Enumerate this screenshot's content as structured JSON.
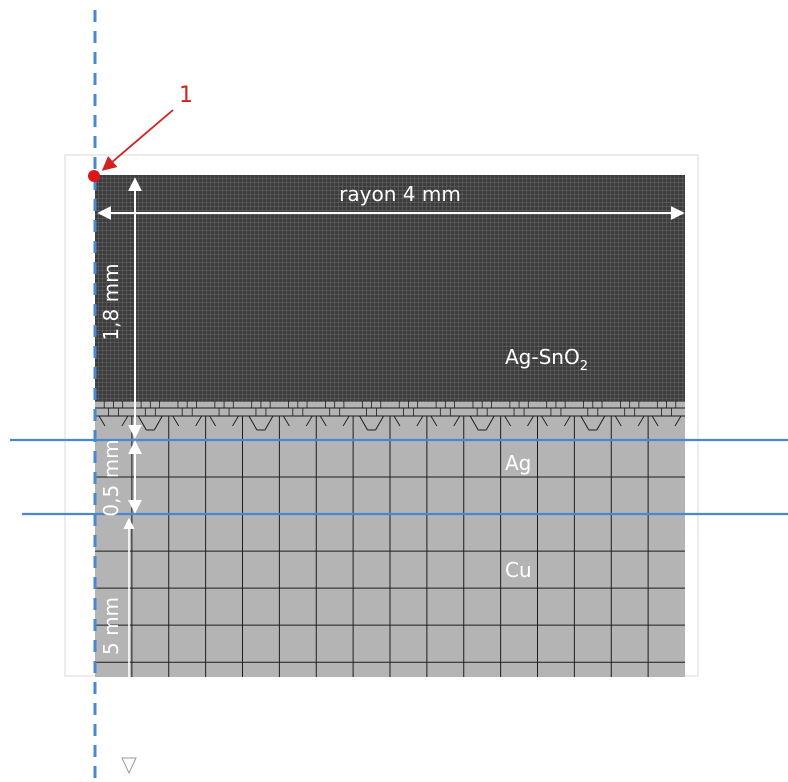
{
  "labels": {
    "callout_number": "1",
    "radius_label": "rayon 4 mm",
    "top_height_label": "1,8 mm",
    "mid_height_label": "0,5 mm",
    "bottom_height_label": "5 mm",
    "material_top_main": "Ag-SnO",
    "material_top_sub": "2",
    "material_mid": "Ag",
    "material_bottom": "Cu"
  },
  "colors": {
    "axis": "#4a86d4",
    "section_line": "#4a86d4",
    "callout": "#d42020",
    "fine_mesh_background": "#3c3c3c",
    "fine_mesh_lines": "#7a7a7a",
    "coarse_mesh_fill": "#b4b4b4",
    "mesh_lines": "#1c1c1c",
    "dimension_arrow": "#ffffff",
    "text_light": "#ffffff"
  },
  "mesh": {
    "coarse_columns": 16,
    "coarse_rows_below_transition": 7,
    "fine_mesh_density": "very fine"
  }
}
